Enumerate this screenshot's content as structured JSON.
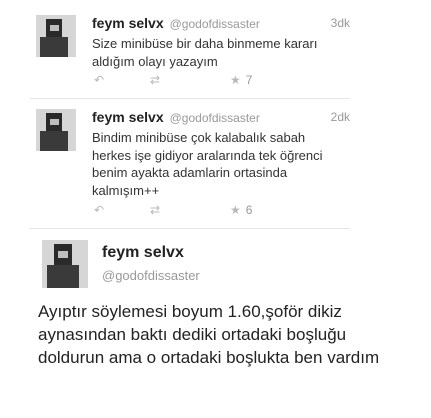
{
  "tweets": [
    {
      "name": "feym selvx",
      "handle": "@godofdissaster",
      "time": "3dk",
      "text": "Size minibüse bir daha binmeme kararı aldığım olayı yazayım",
      "favorites": "7",
      "icons": {
        "reply": "reply-icon",
        "retweet": "retweet-icon",
        "favorite": "star-icon"
      }
    },
    {
      "name": "feym selvx",
      "handle": "@godofdissaster",
      "time": "2dk",
      "text": "Bindim minibüse çok kalabalık sabah herkes işe gidiyor aralarında tek öğrenci benim ayakta adamlarin ortasinda kalmışım++",
      "favorites": "6",
      "icons": {
        "reply": "reply-icon",
        "retweet": "retweet-icon",
        "favorite": "star-icon"
      }
    }
  ],
  "expanded": {
    "name": "feym selvx",
    "handle": "@godofdissaster",
    "text": "Ayıptır söylemesi boyum 1.60,şoför dikiz aynasından baktı dediki ortadaki boşluğu doldurun ama o ortadaki boşlukta ben vardım"
  },
  "colors": {
    "text": "#333333",
    "muted": "#999999",
    "divider": "#e6e6e6"
  }
}
